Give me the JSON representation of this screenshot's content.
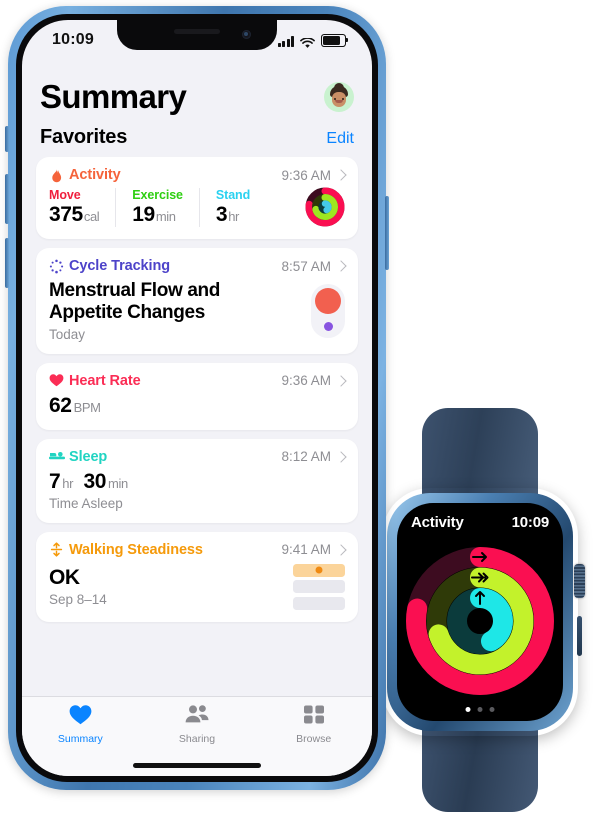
{
  "phone": {
    "status_bar": {
      "time": "10:09",
      "cellular_icon": "signal-bars-icon",
      "wifi_icon": "wifi-icon",
      "battery_icon": "battery-icon"
    },
    "header": {
      "title": "Summary",
      "avatar_icon": "profile-avatar"
    },
    "section": {
      "title": "Favorites",
      "edit_label": "Edit"
    },
    "cards": [
      {
        "id": "activity",
        "name": "Activity",
        "icon": "flame-icon",
        "color": "#f5633b",
        "time": "9:36 AM",
        "metrics": [
          {
            "label": "Move",
            "color": "#f01f3d",
            "value": "375",
            "unit": "cal"
          },
          {
            "label": "Exercise",
            "color": "#4ce600",
            "value": "19",
            "unit": "min"
          },
          {
            "label": "Stand",
            "color": "#2ad1f0",
            "value": "3",
            "unit": "hr"
          }
        ],
        "visual": "activity-rings-mini"
      },
      {
        "id": "cycle-tracking",
        "name": "Cycle Tracking",
        "icon": "cycle-dots-icon",
        "color": "#4d43c9",
        "time": "8:57 AM",
        "headline": "Menstrual Flow and Appetite Changes",
        "subtitle": "Today",
        "visual": "cycle-flow-indicator"
      },
      {
        "id": "heart-rate",
        "name": "Heart Rate",
        "icon": "heart-icon",
        "color": "#fb2d55",
        "time": "9:36 AM",
        "value": "62",
        "unit": "BPM"
      },
      {
        "id": "sleep",
        "name": "Sleep",
        "icon": "bed-icon",
        "color": "#21d4c2",
        "time": "8:12 AM",
        "hours": "7",
        "hours_unit": "hr",
        "minutes": "30",
        "minutes_unit": "min",
        "subtitle": "Time Asleep"
      },
      {
        "id": "walking-steadiness",
        "name": "Walking Steadiness",
        "icon": "updown-arrows-icon",
        "color": "#f59a0b",
        "time": "9:41 AM",
        "status": "OK",
        "subtitle": "Sep 8–14",
        "visual": "steadiness-bars"
      }
    ],
    "tabs": [
      {
        "label": "Summary",
        "icon": "heart-icon",
        "active": true
      },
      {
        "label": "Sharing",
        "icon": "people-icon",
        "active": false
      },
      {
        "label": "Browse",
        "icon": "grid-icon",
        "active": false
      }
    ]
  },
  "watch": {
    "title": "Activity",
    "time": "10:09",
    "rings": [
      {
        "name": "Move",
        "color": "#fa0f51",
        "track": "#3d0c20",
        "progress": 0.78,
        "icon": "arrow-right-icon"
      },
      {
        "name": "Exercise",
        "color": "#c3f22b",
        "track": "#2f3a08",
        "progress": 0.7,
        "icon": "double-arrow-right-icon"
      },
      {
        "name": "Stand",
        "color": "#1ee7e7",
        "track": "#0b3b3c",
        "progress": 0.42,
        "icon": "arrow-up-icon"
      }
    ],
    "page_dots": {
      "count": 3,
      "active_index": 0
    }
  },
  "colors": {
    "accent_blue": "#0a84ff",
    "background": "#f2f2f7",
    "card": "#ffffff",
    "muted_text": "#8e8e93",
    "phone_frame": "#4b85bd",
    "watch_band": "#2d4058"
  }
}
